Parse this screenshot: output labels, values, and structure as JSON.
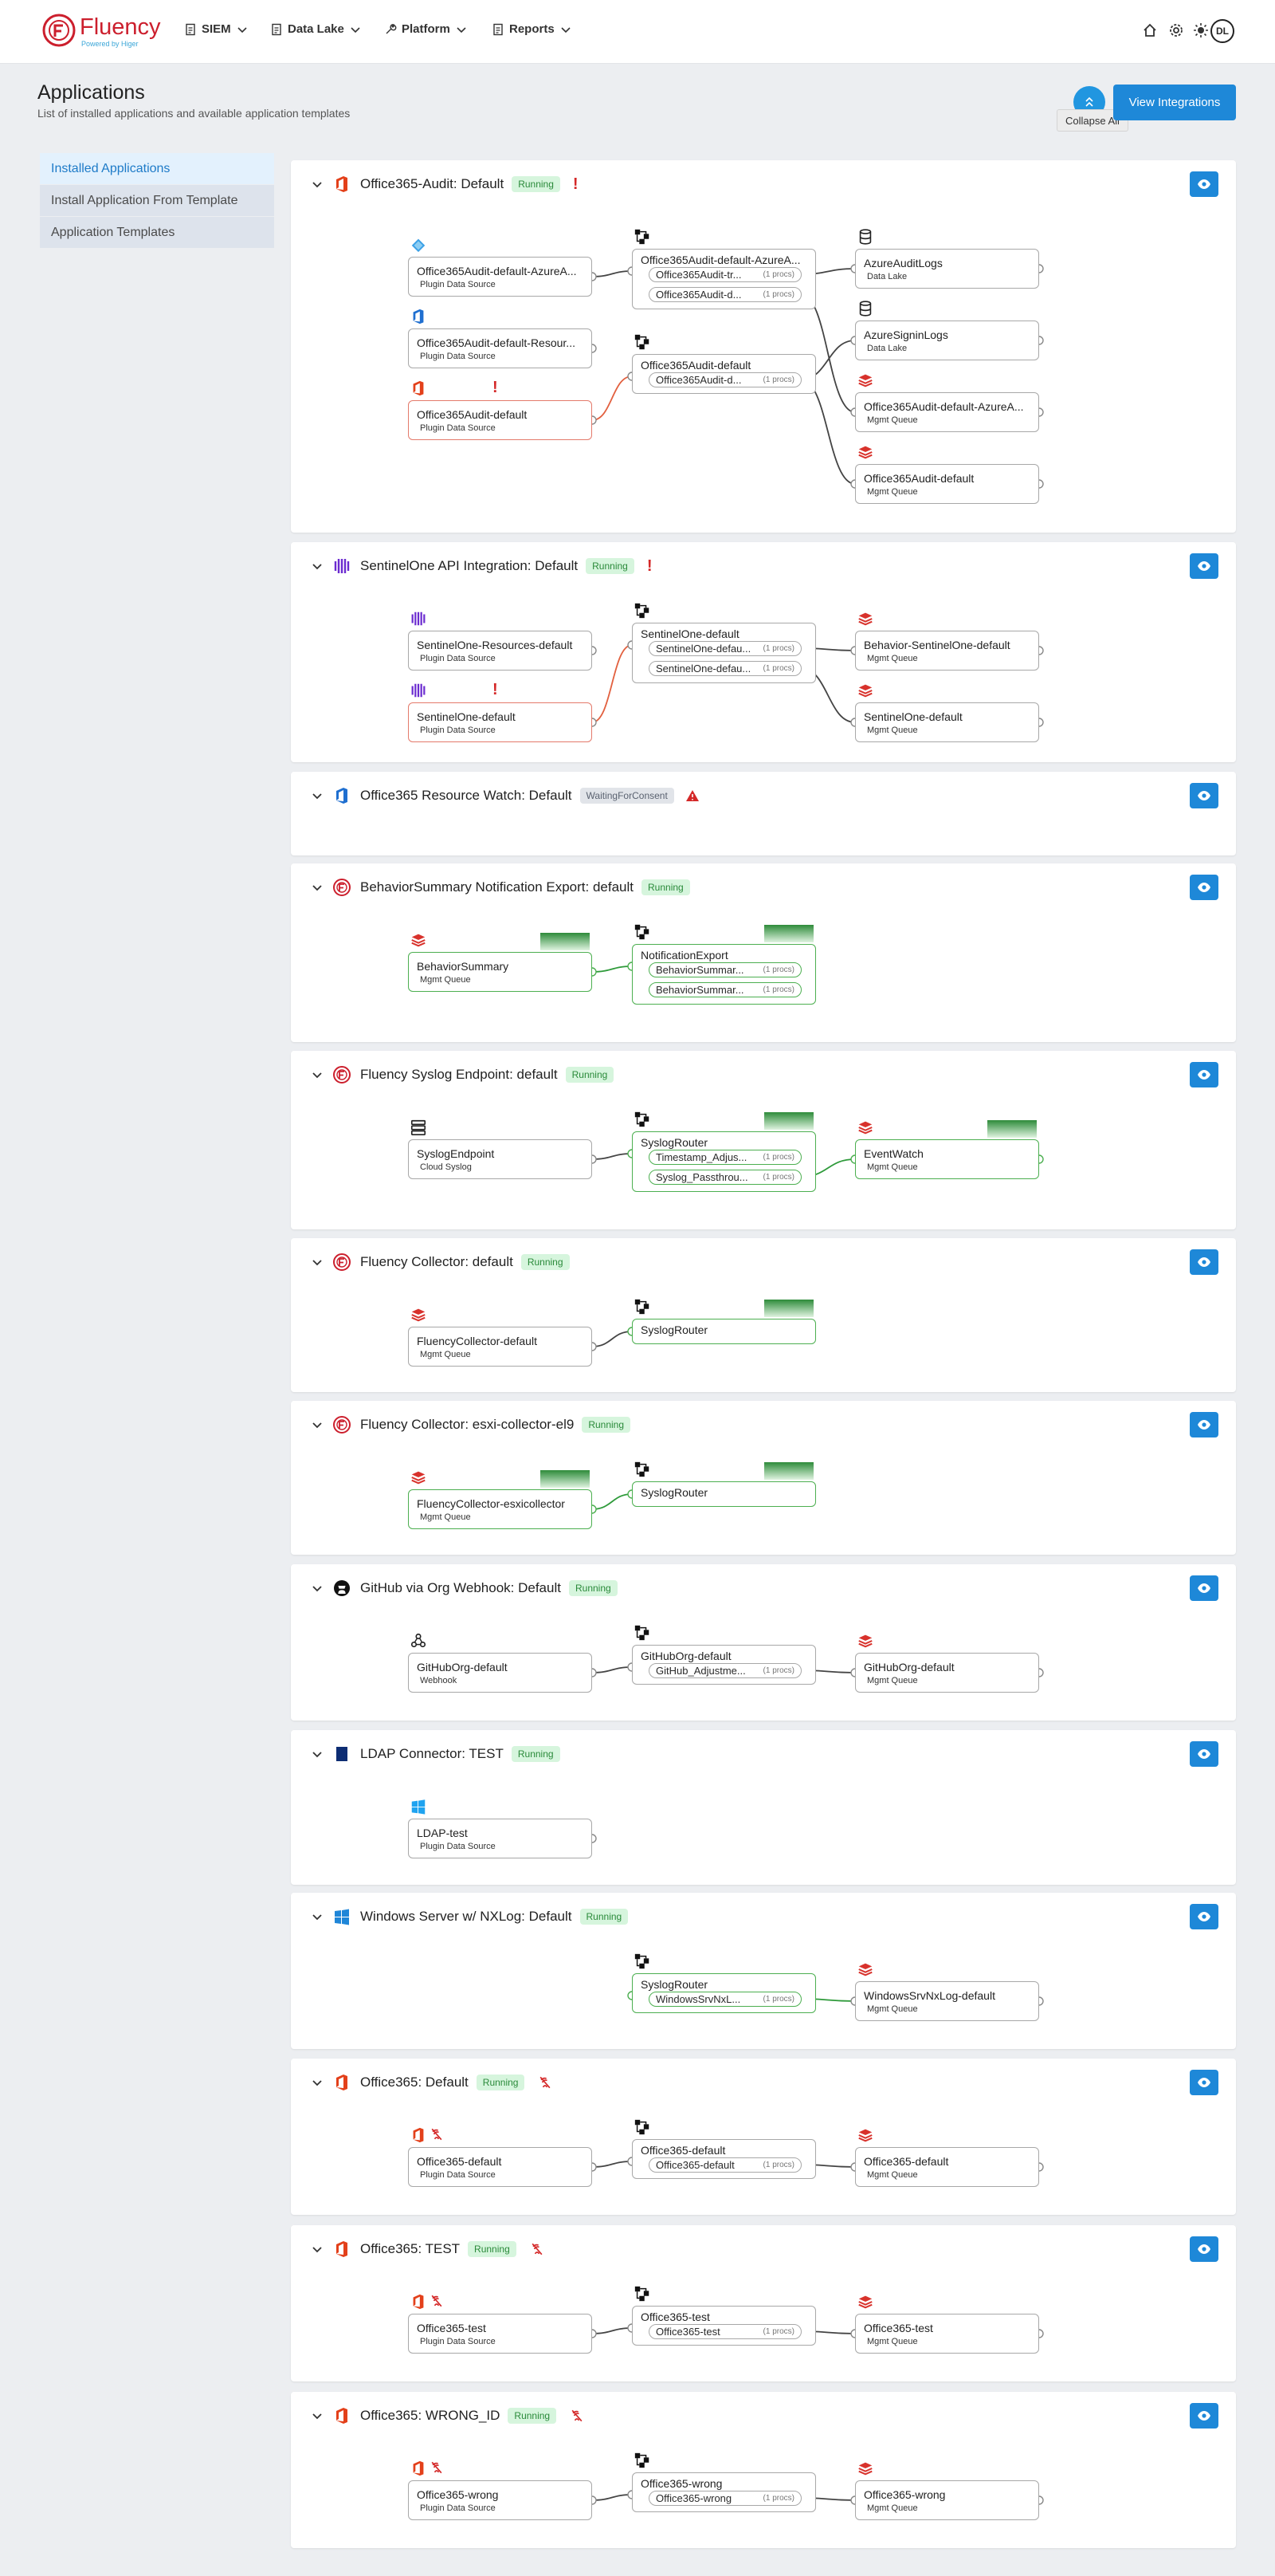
{
  "nav": {
    "logo_text": "Fluency",
    "logo_sub": "Powered by Higer",
    "items": [
      "SIEM",
      "Data Lake",
      "Platform",
      "Reports"
    ],
    "avatar": "DL"
  },
  "header": {
    "title": "Applications",
    "subtitle": "List of installed applications and available application templates",
    "collapse_tooltip": "Collapse All",
    "view_integrations": "View Integrations"
  },
  "sidebar": {
    "items": [
      {
        "label": "Installed Applications",
        "active": true
      },
      {
        "label": "Install Application From Template",
        "active": false
      },
      {
        "label": "Application Templates",
        "active": false
      }
    ]
  },
  "apps": [
    {
      "title": "Office365-Audit: Default",
      "status": "Running",
      "icon": "office-icon",
      "alert": "error",
      "nodes": [
        {
          "name": "Office365Audit-default-AzureA...",
          "type": "Plugin Data Source",
          "icon": "azure-icon"
        },
        {
          "name": "Office365Audit-default-Resour...",
          "type": "Plugin Data Source",
          "icon": "office-blue-icon"
        },
        {
          "name": "Office365Audit-default",
          "type": "Plugin Data Source",
          "icon": "office-icon",
          "error": true
        },
        {
          "name": "Office365Audit-default-AzureA...",
          "type": "Router",
          "procs": [
            {
              "name": "Office365Audit-tr...",
              "count": "(1 procs)"
            },
            {
              "name": "Office365Audit-d...",
              "count": "(1 procs)"
            }
          ]
        },
        {
          "name": "Office365Audit-default",
          "type": "Router",
          "procs": [
            {
              "name": "Office365Audit-d...",
              "count": "(1 procs)"
            }
          ]
        },
        {
          "name": "AzureAuditLogs",
          "type": "Data Lake",
          "icon": "database-icon"
        },
        {
          "name": "AzureSigninLogs",
          "type": "Data Lake",
          "icon": "database-icon"
        },
        {
          "name": "Office365Audit-default-AzureA...",
          "type": "Mgmt Queue",
          "icon": "queue-icon"
        },
        {
          "name": "Office365Audit-default",
          "type": "Mgmt Queue",
          "icon": "queue-icon"
        }
      ]
    },
    {
      "title": "SentinelOne API Integration: Default",
      "status": "Running",
      "icon": "sentinelone-icon",
      "alert": "error",
      "nodes": [
        {
          "name": "SentinelOne-Resources-default",
          "type": "Plugin Data Source",
          "icon": "sentinelone-icon"
        },
        {
          "name": "SentinelOne-default",
          "type": "Plugin Data Source",
          "icon": "sentinelone-icon",
          "error": true
        },
        {
          "name": "SentinelOne-default",
          "type": "Router",
          "procs": [
            {
              "name": "SentinelOne-defau...",
              "count": "(1 procs)"
            },
            {
              "name": "SentinelOne-defau...",
              "count": "(1 procs)"
            }
          ]
        },
        {
          "name": "Behavior-SentinelOne-default",
          "type": "Mgmt Queue",
          "icon": "queue-icon"
        },
        {
          "name": "SentinelOne-default",
          "type": "Mgmt Queue",
          "icon": "queue-icon"
        }
      ]
    },
    {
      "title": "Office365 Resource Watch: Default",
      "status": "WaitingForConsent",
      "icon": "office-blue-icon",
      "alert": "warning",
      "nodes": []
    },
    {
      "title": "BehaviorSummary Notification Export: default",
      "status": "Running",
      "icon": "fluency-icon",
      "nodes": [
        {
          "name": "BehaviorSummary",
          "type": "Mgmt Queue",
          "icon": "queue-icon"
        },
        {
          "name": "NotificationExport",
          "type": "Router",
          "procs": [
            {
              "name": "BehaviorSummar...",
              "count": "(1 procs)"
            },
            {
              "name": "BehaviorSummar...",
              "count": "(1 procs)"
            }
          ]
        }
      ]
    },
    {
      "title": "Fluency Syslog Endpoint: default",
      "status": "Running",
      "icon": "fluency-icon",
      "nodes": [
        {
          "name": "SyslogEndpoint",
          "type": "Cloud Syslog",
          "icon": "server-icon"
        },
        {
          "name": "SyslogRouter",
          "type": "Router",
          "procs": [
            {
              "name": "Timestamp_Adjus...",
              "count": "(1 procs)"
            },
            {
              "name": "Syslog_Passthrou...",
              "count": "(1 procs)"
            }
          ]
        },
        {
          "name": "EventWatch",
          "type": "Mgmt Queue",
          "icon": "queue-icon"
        }
      ]
    },
    {
      "title": "Fluency Collector: default",
      "status": "Running",
      "icon": "fluency-icon",
      "nodes": [
        {
          "name": "FluencyCollector-default",
          "type": "Mgmt Queue",
          "icon": "queue-icon"
        },
        {
          "name": "SyslogRouter",
          "type": "Router",
          "procs": []
        }
      ]
    },
    {
      "title": "Fluency Collector: esxi-collector-el9",
      "status": "Running",
      "icon": "fluency-icon",
      "nodes": [
        {
          "name": "FluencyCollector-esxicollector",
          "type": "Mgmt Queue",
          "icon": "queue-icon"
        },
        {
          "name": "SyslogRouter",
          "type": "Router",
          "procs": []
        }
      ]
    },
    {
      "title": "GitHub via Org Webhook: Default",
      "status": "Running",
      "icon": "github-icon",
      "nodes": [
        {
          "name": "GitHubOrg-default",
          "type": "Webhook",
          "icon": "webhook-icon"
        },
        {
          "name": "GitHubOrg-default",
          "type": "Router",
          "procs": [
            {
              "name": "GitHub_Adjustme...",
              "count": "(1 procs)"
            }
          ]
        },
        {
          "name": "GitHubOrg-default",
          "type": "Mgmt Queue",
          "icon": "queue-icon"
        }
      ]
    },
    {
      "title": "LDAP Connector: TEST",
      "status": "Running",
      "icon": "ldap-icon",
      "nodes": [
        {
          "name": "LDAP-test",
          "type": "Plugin Data Source",
          "icon": "windows-icon"
        }
      ]
    },
    {
      "title": "Windows Server w/ NXLog: Default",
      "status": "Running",
      "icon": "windows-server-icon",
      "nodes": [
        {
          "name": "SyslogRouter",
          "type": "Router",
          "procs": [
            {
              "name": "WindowsSrvNxL...",
              "count": "(1 procs)"
            }
          ]
        },
        {
          "name": "WindowsSrvNxLog-default",
          "type": "Mgmt Queue",
          "icon": "queue-icon"
        }
      ]
    },
    {
      "title": "Office365: Default",
      "status": "Running",
      "icon": "office-icon",
      "alert": "disconnected",
      "nodes": [
        {
          "name": "Office365-default",
          "type": "Plugin Data Source",
          "icon": "office-icon"
        },
        {
          "name": "Office365-default",
          "type": "Router",
          "procs": [
            {
              "name": "Office365-default",
              "count": "(1 procs)"
            }
          ]
        },
        {
          "name": "Office365-default",
          "type": "Mgmt Queue",
          "icon": "queue-icon"
        }
      ]
    },
    {
      "title": "Office365: TEST",
      "status": "Running",
      "icon": "office-icon",
      "alert": "disconnected",
      "nodes": [
        {
          "name": "Office365-test",
          "type": "Plugin Data Source",
          "icon": "office-icon"
        },
        {
          "name": "Office365-test",
          "type": "Router",
          "procs": [
            {
              "name": "Office365-test",
              "count": "(1 procs)"
            }
          ]
        },
        {
          "name": "Office365-test",
          "type": "Mgmt Queue",
          "icon": "queue-icon"
        }
      ]
    },
    {
      "title": "Office365: WRONG_ID",
      "status": "Running",
      "icon": "office-icon",
      "alert": "disconnected",
      "nodes": [
        {
          "name": "Office365-wrong",
          "type": "Plugin Data Source",
          "icon": "office-icon"
        },
        {
          "name": "Office365-wrong",
          "type": "Router",
          "procs": [
            {
              "name": "Office365-wrong",
              "count": "(1 procs)"
            }
          ]
        },
        {
          "name": "Office365-wrong",
          "type": "Mgmt Queue",
          "icon": "queue-icon"
        }
      ]
    }
  ],
  "colors": {
    "primary": "#1e88d8",
    "running_bg": "#d6f5dd",
    "error": "#d42828",
    "ok_edge": "#4caf50"
  }
}
